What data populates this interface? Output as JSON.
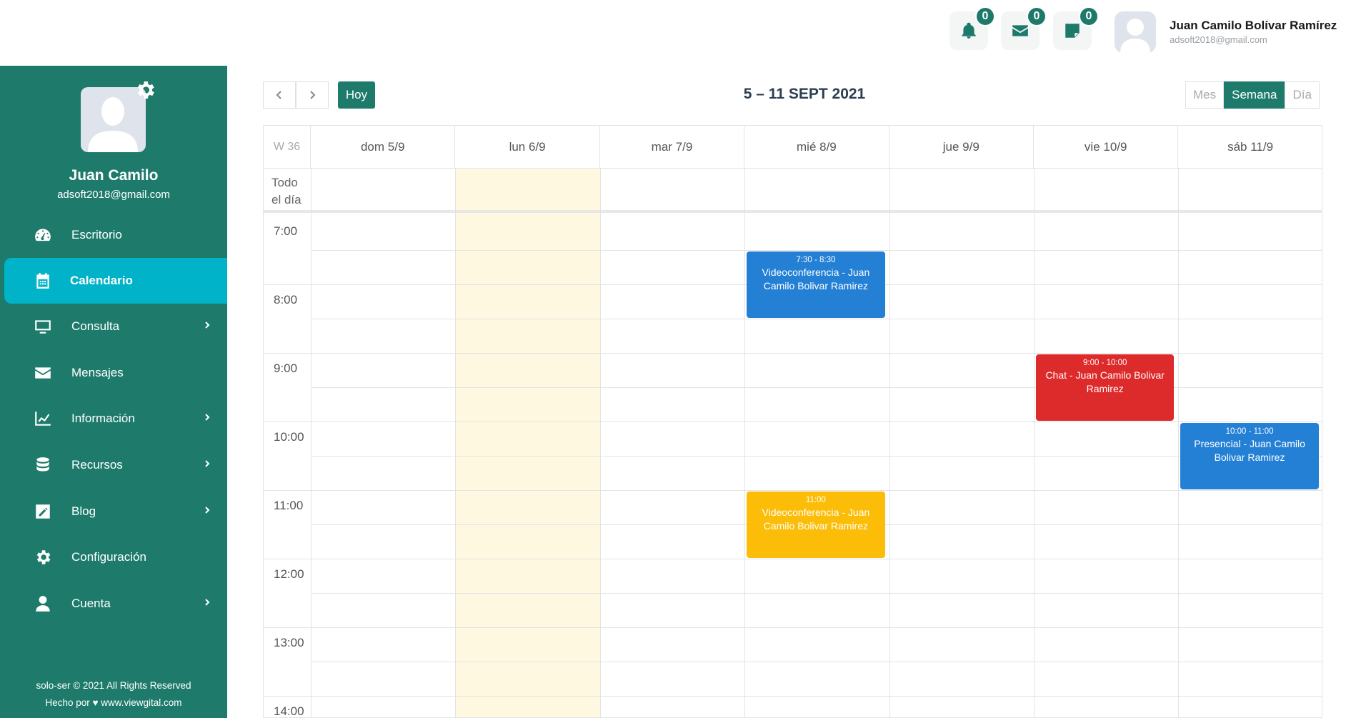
{
  "header": {
    "notifications_count": "0",
    "messages_count": "0",
    "notes_count": "0",
    "user_name": "Juan Camilo Bolívar Ramírez",
    "user_email": "adsoft2018@gmail.com"
  },
  "sidebar": {
    "name": "Juan Camilo",
    "email": "adsoft2018@gmail.com",
    "items": [
      {
        "label": "Escritorio",
        "icon": "dashboard-icon",
        "chevron": false
      },
      {
        "label": "Calendario",
        "icon": "calendar-icon",
        "chevron": false,
        "active": true
      },
      {
        "label": "Consulta",
        "icon": "monitor-icon",
        "chevron": true
      },
      {
        "label": "Mensajes",
        "icon": "envelope-icon",
        "chevron": false
      },
      {
        "label": "Información",
        "icon": "chart-line-icon",
        "chevron": true
      },
      {
        "label": "Recursos",
        "icon": "database-icon",
        "chevron": true
      },
      {
        "label": "Blog",
        "icon": "edit-icon",
        "chevron": true
      },
      {
        "label": "Configuración",
        "icon": "gear-icon",
        "chevron": false
      },
      {
        "label": "Cuenta",
        "icon": "user-icon",
        "chevron": true
      }
    ],
    "footer_line1": "solo-ser © 2021 All Rights Reserved",
    "footer_line2": "Hecho por ♥ www.viewgital.com"
  },
  "calendar": {
    "today_label": "Hoy",
    "title": "5 – 11 SEPT 2021",
    "views": [
      "Mes",
      "Semana",
      "Día"
    ],
    "active_view": "Semana",
    "week_label": "W 36",
    "allday_label": "Todo el día",
    "days": [
      "dom 5/9",
      "lun 6/9",
      "mar 7/9",
      "mié 8/9",
      "jue 9/9",
      "vie 10/9",
      "sáb 11/9"
    ],
    "today_index": 1,
    "times": [
      "7:00",
      "8:00",
      "9:00",
      "10:00",
      "11:00",
      "12:00",
      "13:00",
      "14:00"
    ],
    "events": [
      {
        "day": 3,
        "start": 7.5,
        "end": 8.5,
        "time": "7:30 - 8:30",
        "title": "Videoconferencia - Juan Camilo Bolivar Ramirez",
        "color": "#2480d5"
      },
      {
        "day": 5,
        "start": 9.0,
        "end": 10.0,
        "time": "9:00 - 10:00",
        "title": "Chat - Juan Camilo Bolivar Ramirez",
        "color": "#dd2a2a"
      },
      {
        "day": 6,
        "start": 10.0,
        "end": 11.0,
        "time": "10:00 - 11:00",
        "title": "Presencial - Juan Camilo Bolivar Ramirez",
        "color": "#2480d5"
      },
      {
        "day": 3,
        "start": 11.0,
        "end": 12.0,
        "time": "11:00",
        "title": "Videoconferencia - Juan Camilo Bolivar Ramirez",
        "color": "#fbbd08"
      }
    ]
  }
}
